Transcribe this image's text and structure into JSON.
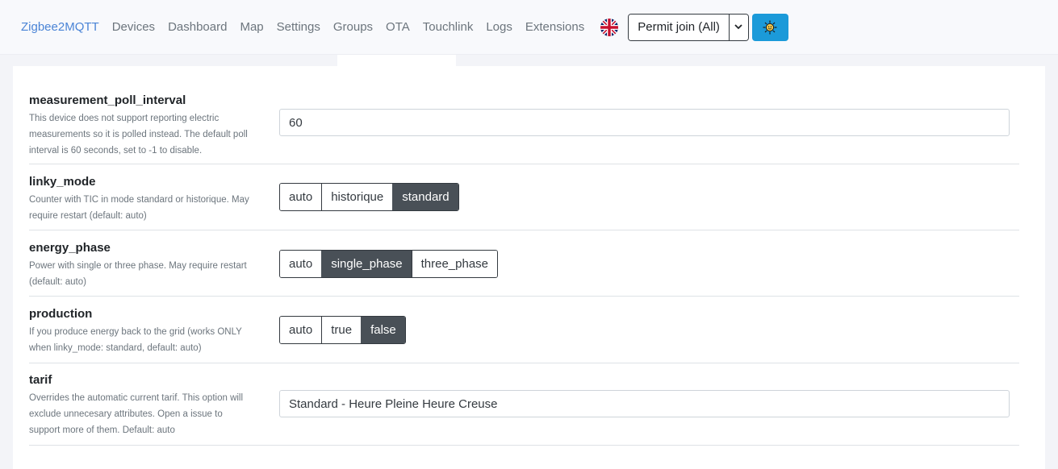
{
  "navbar": {
    "brand": "Zigbee2MQTT",
    "links": [
      "Devices",
      "Dashboard",
      "Map",
      "Settings",
      "Groups",
      "OTA",
      "Touchlink",
      "Logs",
      "Extensions"
    ],
    "permit_join_label": "Permit join (All)",
    "flag_icon": "uk-flag-icon",
    "theme_icon": "sun-icon"
  },
  "settings": [
    {
      "name": "measurement_poll_interval",
      "description": [
        "This device does not support reporting electric",
        "measurements so it is polled instead. The default poll",
        "interval is 60 seconds, set to -1 to disable."
      ],
      "type": "input",
      "value": "60"
    },
    {
      "name": "linky_mode",
      "description": [
        "Counter with TIC in mode standard or historique. May",
        "require restart (default: auto)"
      ],
      "type": "select",
      "options": [
        "auto",
        "historique",
        "standard"
      ],
      "selected": "standard"
    },
    {
      "name": "energy_phase",
      "description": [
        "Power with single or three phase. May require restart",
        "(default: auto)"
      ],
      "type": "select",
      "options": [
        "auto",
        "single_phase",
        "three_phase"
      ],
      "selected": "single_phase"
    },
    {
      "name": "production",
      "description": [
        "If you produce energy back to the grid (works ONLY",
        "when linky_mode: standard, default: auto)"
      ],
      "type": "select",
      "options": [
        "auto",
        "true",
        "false"
      ],
      "selected": "false"
    },
    {
      "name": "tarif",
      "description": [
        "Overrides the automatic current tarif. This option will",
        "exclude unnecesary attributes. Open a issue to",
        "support more of them. Default: auto"
      ],
      "type": "input",
      "value": "Standard - Heure Pleine Heure Creuse"
    }
  ]
}
